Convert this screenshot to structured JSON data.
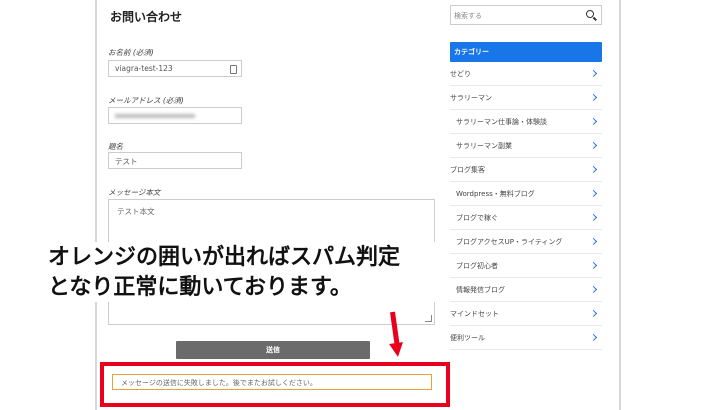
{
  "form": {
    "title": "お問い合わせ",
    "name_label": "お名前 (必須)",
    "name_value": "viagra-test-123",
    "email_label": "メールアドレス (必須)",
    "subject_label": "題名",
    "subject_value": "テスト",
    "message_label": "メッセージ本文",
    "message_value": "テスト本文",
    "submit_label": "送信",
    "error_message": "メッセージの送信に失敗しました。後でまたお試しください。"
  },
  "annotation": {
    "line1": "オレンジの囲いが出ればスパム判定",
    "line2": "となり正常に動いております。",
    "color": "#e8001c"
  },
  "sidebar": {
    "search_placeholder": "検索する",
    "category_header": "カテゴリー",
    "accent_color": "#1976e8",
    "items": [
      {
        "label": "せどり",
        "sub": false
      },
      {
        "label": "サラリーマン",
        "sub": false
      },
      {
        "label": "サラリーマン仕事論・体験談",
        "sub": true
      },
      {
        "label": "サラリーマン副業",
        "sub": true
      },
      {
        "label": "ブログ集客",
        "sub": false
      },
      {
        "label": "Wordpress・無料ブログ",
        "sub": true
      },
      {
        "label": "ブログで稼ぐ",
        "sub": true
      },
      {
        "label": "ブログアクセスUP・ライティング",
        "sub": true
      },
      {
        "label": "ブログ初心者",
        "sub": true
      },
      {
        "label": "情報発信ブログ",
        "sub": true
      },
      {
        "label": "マインドセット",
        "sub": false
      },
      {
        "label": "便利ツール",
        "sub": false
      }
    ]
  }
}
